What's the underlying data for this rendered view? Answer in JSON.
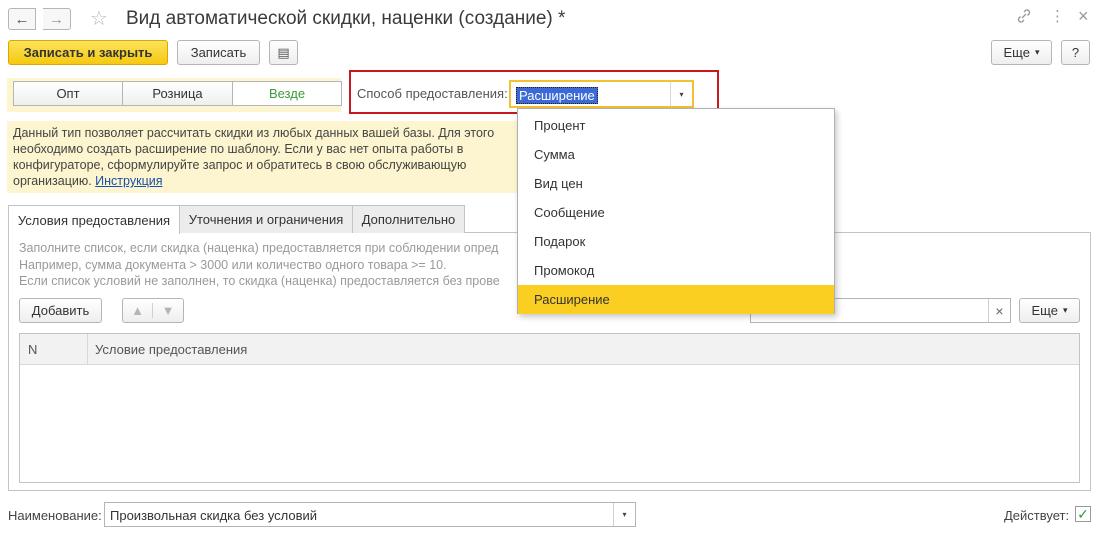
{
  "window": {
    "title": "Вид автоматической скидки, наценки (создание) *",
    "back_icon": "←",
    "forward_icon": "→",
    "star_icon": "☆",
    "link_icon": "🔗",
    "menu_icon": "⋮",
    "close_icon": "×"
  },
  "toolbar": {
    "save_close_label": "Записать и закрыть",
    "save_label": "Записать",
    "doc_icon": "▤",
    "more_label": "Еще",
    "more_arrow": "▾",
    "help_label": "?"
  },
  "segments": [
    "Опт",
    "Розница",
    "Везде"
  ],
  "method": {
    "label": "Способ предоставления:",
    "value": "Расширение",
    "arrow": "▾"
  },
  "info": {
    "text": "Данный тип позволяет рассчитать скидки из любых данных вашей базы. Для этого необходимо создать расширение по шаблону. Если у вас нет опыта работы в конфигураторе, сформулируйте запрос и обратитесь в свою обслуживающую организацию. ",
    "link": "Инструкция"
  },
  "tabs": [
    "Условия предоставления",
    "Уточнения и ограничения",
    "Дополнительно"
  ],
  "hints": [
    "Заполните список, если скидка (наценка) предоставляется при соблюдении опред",
    "Например, сумма документа > 3000 или количество одного товара >= 10.",
    "Если список условий не заполнен, то скидка (наценка) предоставляется без прове"
  ],
  "table_toolbar": {
    "add_label": "Добавить",
    "up_icon": "🡅",
    "down_icon": "🡇",
    "clear_icon": "×",
    "more_label": "Еще",
    "more_arrow": "▾"
  },
  "table": {
    "columns": [
      "N",
      "Условие предоставления"
    ],
    "rows": []
  },
  "dropdown": {
    "options": [
      "Процент",
      "Сумма",
      "Вид цен",
      "Сообщение",
      "Подарок",
      "Промокод",
      "Расширение"
    ],
    "selected": "Расширение"
  },
  "footer": {
    "name_label": "Наименование:",
    "name_value": "Произвольная скидка без условий",
    "name_arrow": "▾",
    "active_label": "Действует:",
    "active_checked": "✓"
  },
  "colors": {
    "primary": "#f5c90f",
    "highlight_border": "#c8191e",
    "selected_item": "#fbcf22",
    "info_bg": "#fdf5cf",
    "active_segment_text": "#3c9a3c",
    "link": "#1a4fa8"
  }
}
